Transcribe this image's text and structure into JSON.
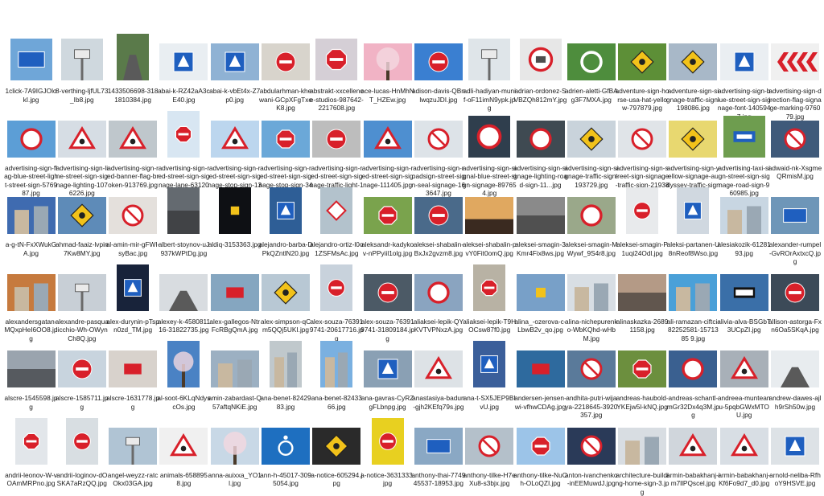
{
  "files": [
    {
      "name": "1click-7A9IGJOlokI.jpg",
      "thumb": {
        "kind": "sq",
        "bg": "#6fa6d8",
        "sign": "blue-rect"
      }
    },
    {
      "name": "8-verthing-ljfUL73_Ib8.jpg",
      "thumb": {
        "kind": "sq",
        "bg": "#cfd8de",
        "sign": "pole"
      }
    },
    {
      "name": "1433506698-3181810384.jpg",
      "thumb": {
        "kind": "p",
        "bg": "#5a7a4a",
        "sign": "road"
      }
    },
    {
      "name": "abai-k-RZ42aA3cE40.jpg",
      "thumb": {
        "kind": "l",
        "bg": "#e9eef2",
        "sign": "blue-sq"
      }
    },
    {
      "name": "abai-k-vbEt4x-Z7p0.jpg",
      "thumb": {
        "kind": "l",
        "bg": "#8fb2d4",
        "sign": "blue-sq"
      }
    },
    {
      "name": "abdularhman-khewani-GCpXFgTxeK8.jpg",
      "thumb": {
        "kind": "l",
        "bg": "#d8d4cc",
        "sign": "no-entry"
      }
    },
    {
      "name": "abstrakt-xxcellence-studios-987642-2217608.jpg",
      "thumb": {
        "kind": "sq",
        "bg": "#d5cfd6",
        "sign": "stop"
      }
    },
    {
      "name": "ace-lucas-HnMhNT_HZEw.jpg",
      "thumb": {
        "kind": "l",
        "bg": "#f1b3c5",
        "sign": "tree"
      }
    },
    {
      "name": "adison-davis-QBnlwqzuJDI.jpg",
      "thumb": {
        "kind": "l",
        "bg": "#3a7fd1",
        "sign": "no-entry"
      }
    },
    {
      "name": "adli-hadiyan-munif-oF11imN9ypk.jpg",
      "thumb": {
        "kind": "sq",
        "bg": "#dfe5e9",
        "sign": "pole"
      }
    },
    {
      "name": "adrian-ordonez-SVBZQh812mY.jpg",
      "thumb": {
        "kind": "sq",
        "bg": "#e7e7e7",
        "sign": "speed30"
      }
    },
    {
      "name": "adrien-aletti-GfBAg3F7MXA.jpg",
      "thumb": {
        "kind": "l",
        "bg": "#4e8d3d",
        "sign": "ring"
      }
    },
    {
      "name": "adventure-sign-horse-usa-hat-yellow-797879.jpg",
      "thumb": {
        "kind": "l",
        "bg": "#5d8f37",
        "sign": "yellow-dia"
      }
    },
    {
      "name": "adventure-sign-signage-traffic-sign-198086.jpg",
      "thumb": {
        "kind": "l",
        "bg": "#a8b8c8",
        "sign": "yellow-dia"
      }
    },
    {
      "name": "advertising-sign-blue-street-sign-signage-font-1405947.jpg",
      "thumb": {
        "kind": "l",
        "bg": "#eaeef2",
        "sign": "blue-sq"
      }
    },
    {
      "name": "advertising-sign-direction-flag-signage-marking-976079.jpg",
      "thumb": {
        "kind": "l",
        "bg": "#f0f0f0",
        "sign": "chevron"
      }
    },
    {
      "name": "advertising-sign-flag-blue-street-light-street-sign-576987.jpg",
      "thumb": {
        "kind": "l",
        "bg": "#5c9ed6",
        "sign": "red-circle"
      }
    },
    {
      "name": "advertising-sign-line-street-sign-signage-lighting-1076226.jpg",
      "thumb": {
        "kind": "l",
        "bg": "#d6dde4",
        "sign": "tri-work"
      }
    },
    {
      "name": "advertising-sign-red-banner-flag-broken-913769.jpg",
      "thumb": {
        "kind": "l",
        "bg": "#bfc7cc",
        "sign": "tri-work"
      }
    },
    {
      "name": "advertising-sign-red-street-sign-signage-lane-631209.jpg",
      "thumb": {
        "kind": "p",
        "bg": "#d8e6f2",
        "sign": "stop"
      }
    },
    {
      "name": "advertising-sign-red-street-sign-signage-stop-sign-138332.jpg",
      "thumb": {
        "kind": "l",
        "bg": "#bcd6ee",
        "sign": "tri-car"
      }
    },
    {
      "name": "advertising-sign-red-street-sign-signage-stop-sign-346054.jpg",
      "thumb": {
        "kind": "l",
        "bg": "#6ba8d8",
        "sign": "stop"
      }
    },
    {
      "name": "advertising-sign-red-street-sign-signage-traffic-light-118248.jpg",
      "thumb": {
        "kind": "l",
        "bg": "#bdbdbd",
        "sign": "no-entry"
      }
    },
    {
      "name": "advertising-sign-red-street-sign-signage-111405.jpg",
      "thumb": {
        "kind": "l",
        "bg": "#4e8fd0",
        "sign": "tri-work"
      }
    },
    {
      "name": "advertising-sign-roadsign-street-sign-seal-signage-163647.jpg",
      "thumb": {
        "kind": "l",
        "bg": "#dde3e8",
        "sign": "no-sign"
      }
    },
    {
      "name": "advertising-sign-signal-blue-street-sign-signage-897654.jpg",
      "thumb": {
        "kind": "sq",
        "bg": "#2f3e4d",
        "sign": "red-circle"
      }
    },
    {
      "name": "advertising-sign-signage-lighting-road-sign-11...jpg",
      "thumb": {
        "kind": "l",
        "bg": "#3f4a52",
        "sign": "red-circle"
      }
    },
    {
      "name": "advertising-sign-signage-traffic-sign-193729.jpg",
      "thumb": {
        "kind": "l",
        "bg": "#c9d3db",
        "sign": "yellow-dia"
      }
    },
    {
      "name": "advertising-sign-street-sign-signage-traffic-sign-219386.jpg",
      "thumb": {
        "kind": "l",
        "bg": "#e0e4e8",
        "sign": "no-sign"
      }
    },
    {
      "name": "advertising-sign-yellow-signage-audyssey-traffic-sign-437...",
      "thumb": {
        "kind": "l",
        "bg": "#e8d870",
        "sign": "yellow-dia"
      }
    },
    {
      "name": "advertising-taxi-sign-street-sign-signage-road-sign-960985.jpg",
      "thumb": {
        "kind": "sq",
        "bg": "#6e9d4f",
        "sign": "taxi"
      }
    },
    {
      "name": "adwaid-nk-XsgmeQRmisM.jpg",
      "thumb": {
        "kind": "l",
        "bg": "#3f5a7a",
        "sign": "no-sign"
      }
    },
    {
      "name": "a-g-tN-FxXWukGA.jpg",
      "thumb": {
        "kind": "l",
        "bg": "#3f6bb0",
        "sign": "building"
      }
    },
    {
      "name": "ahmad-faaiz-lvpin7Kw8MY.jpg",
      "thumb": {
        "kind": "l",
        "bg": "#5e8bb8",
        "sign": "yellow-dia"
      }
    },
    {
      "name": "al-amin-mir-gFWI-syBac.jpg",
      "thumb": {
        "kind": "l",
        "bg": "#e4e0dc",
        "sign": "no-sign"
      }
    },
    {
      "name": "albert-stoynov-uJ937kWPtDg.jpg",
      "thumb": {
        "kind": "p",
        "bg": "#646a70",
        "sign": "dark"
      }
    },
    {
      "name": "aldiq-3153363.jpg",
      "thumb": {
        "kind": "p",
        "bg": "#0e1014",
        "sign": "yellow-small"
      }
    },
    {
      "name": "alejandro-barba-DPkQZntlN20.jpg",
      "thumb": {
        "kind": "p",
        "bg": "#2e5e96",
        "sign": "blue-sq"
      }
    },
    {
      "name": "alejandro-ortiz-l0o1ZSFMsAc.jpg",
      "thumb": {
        "kind": "p",
        "bg": "#b3c2cc",
        "sign": "red-dia"
      }
    },
    {
      "name": "aleksandr-kadykov-nPPyiil1olg.jpg",
      "thumb": {
        "kind": "l",
        "bg": "#7aa34d",
        "sign": "stop"
      }
    },
    {
      "name": "aleksei-shabalin-BxJx2gvzm8.jpg",
      "thumb": {
        "kind": "l",
        "bg": "#4a6a8a",
        "sign": "no-entry"
      }
    },
    {
      "name": "aleksei-shabalin-pvY0Fit0omQ.jpg",
      "thumb": {
        "kind": "l",
        "bg": "#e0a860",
        "sign": "sunset"
      }
    },
    {
      "name": "aleksei-smagin-3Kmr4Fix8ws.jpg",
      "thumb": {
        "kind": "l",
        "bg": "#8a8a8a",
        "sign": "dark"
      }
    },
    {
      "name": "aleksei-smagin-MWywf_9S4r8.jpg",
      "thumb": {
        "kind": "l",
        "bg": "#9aa88a",
        "sign": "red-circle"
      }
    },
    {
      "name": "aleksei-smagin-P1uqi24Odl.jpg",
      "thumb": {
        "kind": "p",
        "bg": "#e8eaec",
        "sign": "no-entry"
      }
    },
    {
      "name": "aleksi-partanen-U8nReof8Wso.jpg",
      "thumb": {
        "kind": "p",
        "bg": "#d0d8e0",
        "sign": "blue-sq"
      }
    },
    {
      "name": "alesiakozik-6128193.jpg",
      "thumb": {
        "kind": "l",
        "bg": "#c8d6e2",
        "sign": "building"
      }
    },
    {
      "name": "alexander-rumpel-GvROrAxtxcQ.jpg",
      "thumb": {
        "kind": "l",
        "bg": "#6e96b8",
        "sign": "blue-rect"
      }
    },
    {
      "name": "alexandersgatan-MQxpHeI6OO8.jpg",
      "thumb": {
        "kind": "l",
        "bg": "#c67a3e",
        "sign": "building"
      }
    },
    {
      "name": "alexandre-pasqualicchio-Wh-OWynCh8Q.jpg",
      "thumb": {
        "kind": "l",
        "bg": "#c8cfd6",
        "sign": "pole"
      }
    },
    {
      "name": "alex-durynin-pTspn0zd_TM.jpg",
      "thumb": {
        "kind": "p",
        "bg": "#18233a",
        "sign": "blue-sq"
      }
    },
    {
      "name": "alexey-k-458081116-31822735.jpg",
      "thumb": {
        "kind": "l",
        "bg": "#d8dce0",
        "sign": "road"
      }
    },
    {
      "name": "alex-gallegos-NtrFcRBgQmA.jpg",
      "thumb": {
        "kind": "l",
        "bg": "#85a6c0",
        "sign": "red-rect"
      }
    },
    {
      "name": "alex-simpson-qCm5QQj5UKI.jpg",
      "thumb": {
        "kind": "l",
        "bg": "#b8c8d4",
        "sign": "yellow-dia"
      }
    },
    {
      "name": "alex-souza-763919741-20617716.jpg",
      "thumb": {
        "kind": "p",
        "bg": "#c8d2dc",
        "sign": "no-entry"
      }
    },
    {
      "name": "alex-souza-763919741-31809184.jpg",
      "thumb": {
        "kind": "l",
        "bg": "#4c5a66",
        "sign": "no-entry"
      }
    },
    {
      "name": "aliaksei-lepik-QYKVTVPNxzA.jpg",
      "thumb": {
        "kind": "l",
        "bg": "#8aa4c0",
        "sign": "red-circle"
      }
    },
    {
      "name": "aliaksei-lepik-T9HOCsw87f0.jpg",
      "thumb": {
        "kind": "p",
        "bg": "#b8b2a4",
        "sign": "stop"
      }
    },
    {
      "name": "alina_-ozerova-c-LbwB2v_qo.jpg",
      "thumb": {
        "kind": "l",
        "bg": "#78a0c8",
        "sign": "yellow-small"
      }
    },
    {
      "name": "alina-nichepurenko-WbKQhd-wHbM.jpg",
      "thumb": {
        "kind": "l",
        "bg": "#d8dee4",
        "sign": "building"
      }
    },
    {
      "name": "alinaskazka-26891158.jpg",
      "thumb": {
        "kind": "l",
        "bg": "#b49a86",
        "sign": "dark"
      }
    },
    {
      "name": "ali-ramazan-ciftci-82252581-1571385 9.jpg",
      "thumb": {
        "kind": "l",
        "bg": "#4aa0d8",
        "sign": "building"
      }
    },
    {
      "name": "alivia-alva-BSGbT3UCpZI.jpg",
      "thumb": {
        "kind": "l",
        "bg": "#3a6fa8",
        "sign": "oneway"
      }
    },
    {
      "name": "allison-astorga-Fxn6Oa5SKqA.jpg",
      "thumb": {
        "kind": "l",
        "bg": "#3c4a58",
        "sign": "no-entry"
      }
    },
    {
      "name": "alscre-1545598.jpg",
      "thumb": {
        "kind": "l",
        "bg": "#9aa4ae",
        "sign": "dark"
      }
    },
    {
      "name": "alscre-1585711.jpg",
      "thumb": {
        "kind": "l",
        "bg": "#c8d4de",
        "sign": "no-entry"
      }
    },
    {
      "name": "alscre-1631778.jpg",
      "thumb": {
        "kind": "l",
        "bg": "#d8d2cc",
        "sign": "red-rect"
      }
    },
    {
      "name": "al-soot-6KLqNdyscOs.jpg",
      "thumb": {
        "kind": "p",
        "bg": "#4a82c4",
        "sign": "tree"
      }
    },
    {
      "name": "amin-zabardast-Q57aftqNKiE.jpg",
      "thumb": {
        "kind": "l",
        "bg": "#9cb0c2",
        "sign": "building"
      }
    },
    {
      "name": "ana-benet-8242983.jpg",
      "thumb": {
        "kind": "p",
        "bg": "#c0c8cc",
        "sign": "building"
      }
    },
    {
      "name": "ana-benet-8243366.jpg",
      "thumb": {
        "kind": "p",
        "bg": "#7ab0e0",
        "sign": "building"
      }
    },
    {
      "name": "ana-gavras-CyRZgFLbnpg.jpg",
      "thumb": {
        "kind": "l",
        "bg": "#8aa0b4",
        "sign": "blue-sq"
      }
    },
    {
      "name": "anastasiya-badun-gjh2KEfq79s.jpg",
      "thumb": {
        "kind": "l",
        "bg": "#dde2e6",
        "sign": "tri-car"
      }
    },
    {
      "name": "ana-t-SX5JEP9BIvU.jpg",
      "thumb": {
        "kind": "p",
        "bg": "#3b5f9a",
        "sign": "blue-sq"
      }
    },
    {
      "name": "andersen-jensen-wi-vfhwCDAg.jpg",
      "thumb": {
        "kind": "l",
        "bg": "#2e6a9e",
        "sign": "red-rect"
      }
    },
    {
      "name": "andhita-putri-wijaya-2218645-3920357.jpg",
      "thumb": {
        "kind": "l",
        "bg": "#5a7a9a",
        "sign": "no-sign"
      }
    },
    {
      "name": "andreas-haubold-YKEjw5l-kNQ.jpg",
      "thumb": {
        "kind": "l",
        "bg": "#6c8f3e",
        "sign": "stop"
      }
    },
    {
      "name": "andreas-schantl-mGr32Dx4q3M.jpg",
      "thumb": {
        "kind": "l",
        "bg": "#3a6090",
        "sign": "red-circle"
      }
    },
    {
      "name": "andreea-muntеanu-5pqbGWxMTOU.jpg",
      "thumb": {
        "kind": "l",
        "bg": "#a8b0b8",
        "sign": "tri-work"
      }
    },
    {
      "name": "andrew-dawes-ajlh9rSh50w.jpg",
      "thumb": {
        "kind": "l",
        "bg": "#e8ecef",
        "sign": "road"
      }
    },
    {
      "name": "andrii-leonov-W-vOAmMRPno.jpg",
      "thumb": {
        "kind": "p",
        "bg": "#e2e6ea",
        "sign": "stop"
      }
    },
    {
      "name": "andrii-loginov-dOSKA7aRzQQ.jpg",
      "thumb": {
        "kind": "p",
        "bg": "#d8dee2",
        "sign": "no-entry"
      }
    },
    {
      "name": "angel-weyzz-ratcOkx03GA.jpg",
      "thumb": {
        "kind": "l",
        "bg": "#b0c4d4",
        "sign": "pole"
      }
    },
    {
      "name": "animals-658895 8.jpg",
      "thumb": {
        "kind": "l",
        "bg": "#f0f0f0",
        "sign": "tri-deer"
      }
    },
    {
      "name": "anna-auixxa_YO1l.jpg",
      "thumb": {
        "kind": "l",
        "bg": "#c8d8e6",
        "sign": "tree"
      }
    },
    {
      "name": "ann-h-45017-3095054.jpg",
      "thumb": {
        "kind": "l",
        "bg": "#1e6fc0",
        "sign": "wheelchair"
      }
    },
    {
      "name": "a-notice-605294.jpg",
      "thumb": {
        "kind": "l",
        "bg": "#2a2a2a",
        "sign": "yellow-dia"
      }
    },
    {
      "name": "a-notice-3631333.jpg",
      "thumb": {
        "kind": "p",
        "bg": "#e8d020",
        "sign": "no-entry"
      }
    },
    {
      "name": "anthony-thai-774945537-18953.jpg",
      "thumb": {
        "kind": "l",
        "bg": "#8aa8c4",
        "sign": "blue-rect"
      }
    },
    {
      "name": "anthony-tilke-H7eXu8-s3bjx.jpg",
      "thumb": {
        "kind": "l",
        "bg": "#b4c0ca",
        "sign": "no-sign"
      }
    },
    {
      "name": "anthony-tilke-NuCh-OLoQZI.jpg",
      "thumb": {
        "kind": "l",
        "bg": "#9cc4e8",
        "sign": "stop"
      }
    },
    {
      "name": "anton-ivanchenko-inEEMuwdJ.jpg",
      "thumb": {
        "kind": "l",
        "bg": "#2a3a58",
        "sign": "no-sign"
      }
    },
    {
      "name": "architecture-building-home-sign-3.jpg",
      "thumb": {
        "kind": "l",
        "bg": "#d8dde2",
        "sign": "building"
      }
    },
    {
      "name": "armin-babakhanj-im7llPQscel.jpg",
      "thumb": {
        "kind": "l",
        "bg": "#d0d6dc",
        "sign": "tri-deer"
      }
    },
    {
      "name": "armin-babakhanj-Kf6Fo9d7_d0.jpg",
      "thumb": {
        "kind": "l",
        "bg": "#d8dee4",
        "sign": "tri-deer"
      }
    },
    {
      "name": "arnold-neliba-RfhoY9HSVE.jpg",
      "thumb": {
        "kind": "l",
        "bg": "#dde2e6",
        "sign": "blue-sq"
      }
    }
  ]
}
